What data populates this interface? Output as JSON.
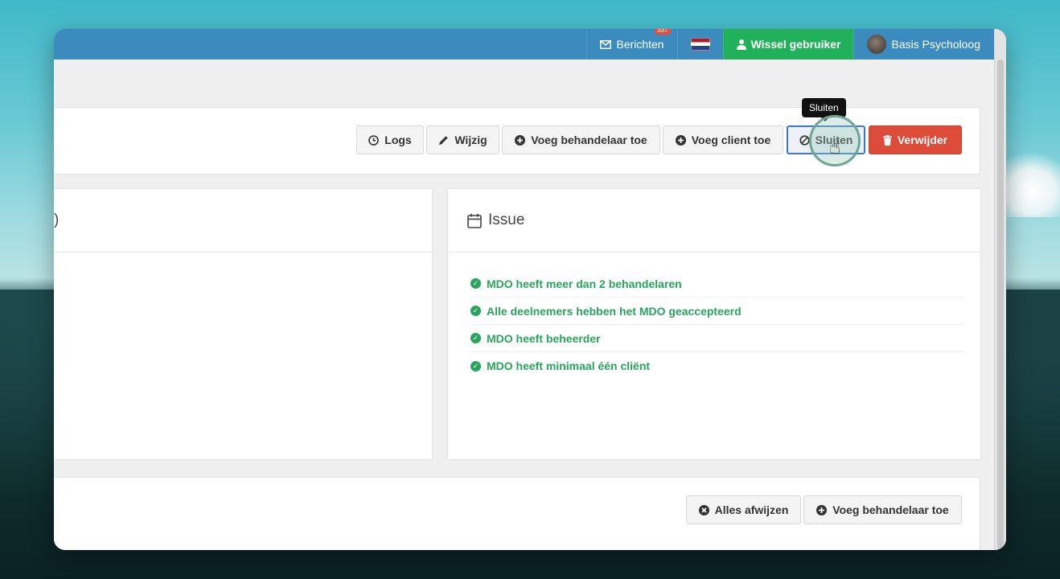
{
  "topbar": {
    "messages_label": "Berichten",
    "messages_badge": "337",
    "switch_user_label": "Wissel gebruiker",
    "user_name": "Basis Psycholoog"
  },
  "toolbar": {
    "logs_label": "Logs",
    "edit_label": "Wijzig",
    "add_practitioner_label": "Voeg behandelaar toe",
    "add_client_label": "Voeg client toe",
    "close_label": "Sluiten",
    "delete_label": "Verwijder",
    "tooltip": "Sluiten"
  },
  "left_panel": {
    "title_fragment": ")"
  },
  "issue_panel": {
    "title": "Issue",
    "items": [
      "MDO heeft meer dan 2 behandelaren",
      "Alle deelnemers hebben het MDO geaccepteerd",
      "MDO heeft beheerder",
      "MDO heeft minimaal één cliënt"
    ]
  },
  "bottom_panel": {
    "reject_all_label": "Alles afwijzen",
    "add_practitioner_label": "Voeg behandelaar toe"
  },
  "colors": {
    "topbar": "#3b8bbf",
    "switch_user": "#21b15a",
    "danger": "#dd4b39",
    "success": "#27a55c"
  }
}
